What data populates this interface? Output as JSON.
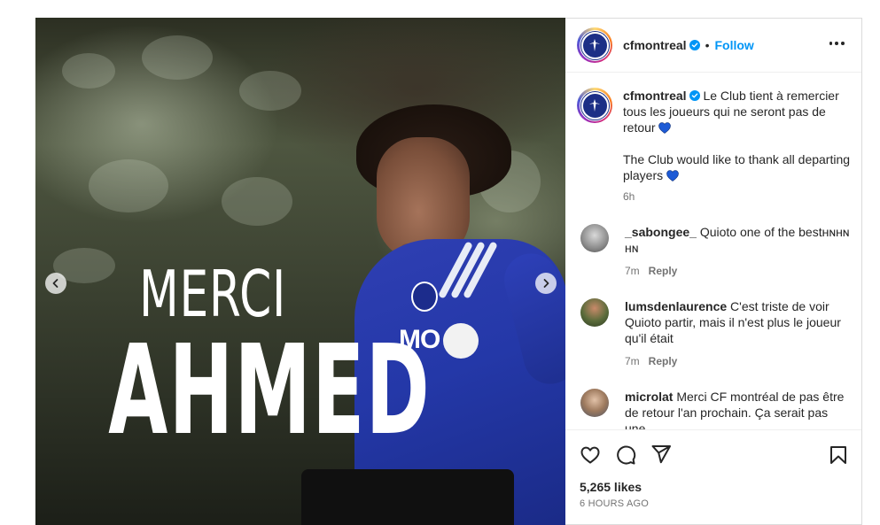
{
  "post": {
    "image_title_line1": "MERCI",
    "image_title_line2": "AHMED",
    "sponsor_text": "MO"
  },
  "header": {
    "username": "cfmontreal",
    "separator": "•",
    "follow_label": "Follow"
  },
  "caption": {
    "username": "cfmontreal",
    "text_fr": "Le Club tient à remercier tous les joueurs qui ne seront pas de retour",
    "text_en": "The Club would like to thank all departing players",
    "time": "6h"
  },
  "comments": [
    {
      "username": "_sabongee_",
      "text": "Quioto one of the bestʜɴʜɴ ʜɴ",
      "time": "7m",
      "reply_label": "Reply"
    },
    {
      "username": "lumsdenlaurence",
      "text": "C'est triste de voir Quioto partir, mais il n'est plus le joueur qu'il était",
      "time": "7m",
      "reply_label": "Reply"
    },
    {
      "username": "microlat",
      "text": "Merci CF montréal de pas être de retour l'an prochain. Ça serait pas une",
      "time": "",
      "reply_label": ""
    }
  ],
  "footer": {
    "likes": "5,265 likes",
    "posted_ago": "6 HOURS AGO"
  },
  "colors": {
    "accent": "#0095f6",
    "heart_emoji": "#1e5bd6",
    "brand_blue": "#1c2f86"
  },
  "icons": [
    "prev-arrow-icon",
    "next-arrow-icon",
    "verified-badge-icon",
    "more-options-icon",
    "like-icon",
    "comment-icon",
    "share-icon",
    "save-icon",
    "blue-heart-icon"
  ]
}
